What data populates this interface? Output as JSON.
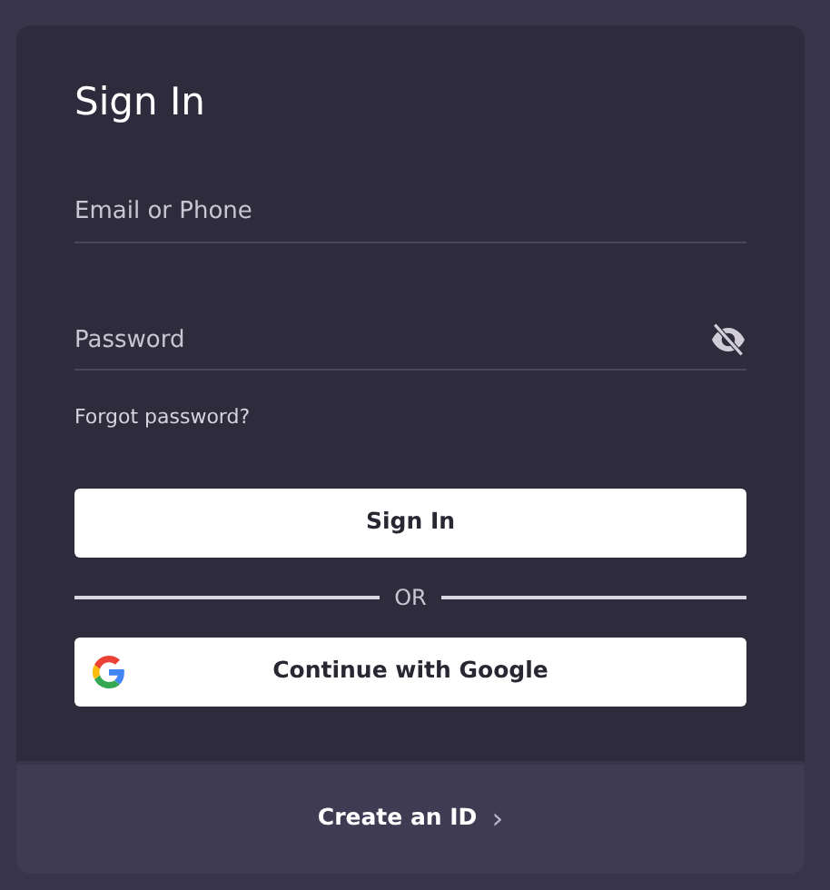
{
  "title": "Sign In",
  "fields": [
    {
      "placeholder": "Email or Phone",
      "kind": "text"
    },
    {
      "placeholder": "Password",
      "kind": "password"
    }
  ],
  "forgot_link": "Forgot password?",
  "sign_in_button": "Sign In",
  "divider_text": "OR",
  "google_button": "Continue with Google",
  "footer_link": "Create an ID",
  "footer_chevron": "›"
}
